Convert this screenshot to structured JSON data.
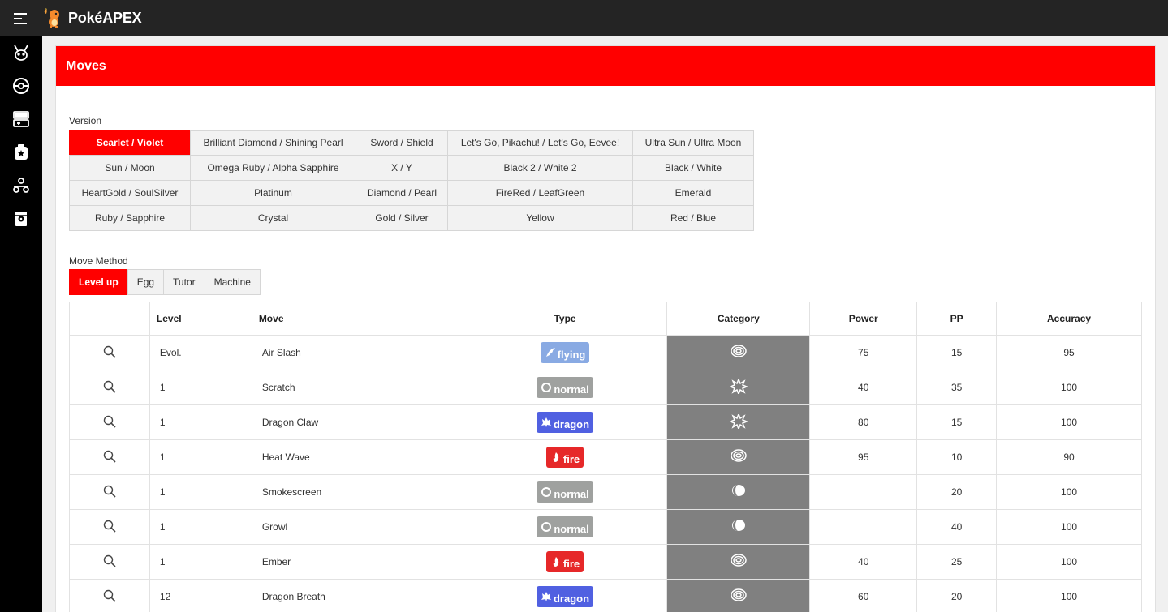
{
  "app": {
    "title": "PokéAPEX"
  },
  "sidebar": {
    "items": [
      "pikachu-icon",
      "pokeball-icon",
      "game-console-icon",
      "items-bag-icon",
      "team-icon",
      "pokedex-card-icon"
    ]
  },
  "card": {
    "title": "Moves"
  },
  "version": {
    "label": "Version",
    "selected": "Scarlet / Violet",
    "options": [
      "Scarlet / Violet",
      "Brilliant Diamond / Shining Pearl",
      "Sword / Shield",
      "Let's Go, Pikachu! / Let's Go, Eevee!",
      "Ultra Sun / Ultra Moon",
      "Sun / Moon",
      "Omega Ruby / Alpha Sapphire",
      "X / Y",
      "Black 2 / White 2",
      "Black / White",
      "HeartGold / SoulSilver",
      "Platinum",
      "Diamond / Pearl",
      "FireRed / LeafGreen",
      "Emerald",
      "Ruby / Sapphire",
      "Crystal",
      "Gold / Silver",
      "Yellow",
      "Red / Blue"
    ]
  },
  "method": {
    "label": "Move Method",
    "selected": "Level up",
    "options": [
      "Level up",
      "Egg",
      "Tutor",
      "Machine"
    ]
  },
  "table": {
    "headers": [
      "",
      "Level",
      "Move",
      "Type",
      "Category",
      "Power",
      "PP",
      "Accuracy"
    ],
    "rows": [
      {
        "level": "Evol.",
        "move": "Air Slash",
        "type": "flying",
        "category": "special",
        "power": "75",
        "pp": "15",
        "accuracy": "95"
      },
      {
        "level": "1",
        "move": "Scratch",
        "type": "normal",
        "category": "physical",
        "power": "40",
        "pp": "35",
        "accuracy": "100"
      },
      {
        "level": "1",
        "move": "Dragon Claw",
        "type": "dragon",
        "category": "physical",
        "power": "80",
        "pp": "15",
        "accuracy": "100"
      },
      {
        "level": "1",
        "move": "Heat Wave",
        "type": "fire",
        "category": "special",
        "power": "95",
        "pp": "10",
        "accuracy": "90"
      },
      {
        "level": "1",
        "move": "Smokescreen",
        "type": "normal",
        "category": "status",
        "power": "",
        "pp": "20",
        "accuracy": "100"
      },
      {
        "level": "1",
        "move": "Growl",
        "type": "normal",
        "category": "status",
        "power": "",
        "pp": "40",
        "accuracy": "100"
      },
      {
        "level": "1",
        "move": "Ember",
        "type": "fire",
        "category": "special",
        "power": "40",
        "pp": "25",
        "accuracy": "100"
      },
      {
        "level": "12",
        "move": "Dragon Breath",
        "type": "dragon",
        "category": "special",
        "power": "60",
        "pp": "20",
        "accuracy": "100"
      }
    ]
  },
  "colors": {
    "accent": "#ff0000",
    "topbar": "#242424",
    "sidebar": "#000000",
    "category_bg": "#808080",
    "type_flying": "#89aae3",
    "type_normal": "#9fa19f",
    "type_dragon": "#5060e1",
    "type_fire": "#e62829"
  }
}
